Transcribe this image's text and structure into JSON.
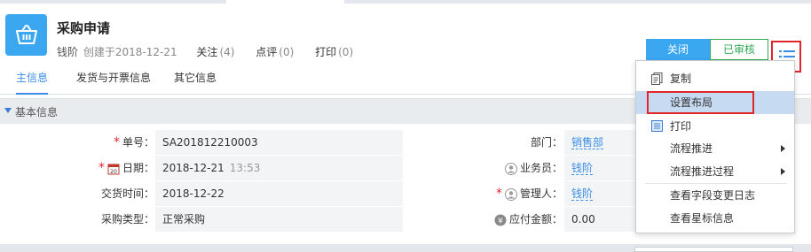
{
  "header": {
    "title": "采购申请",
    "creator": "钱阶",
    "created_text": "创建于2018-12-21",
    "actions": [
      {
        "label": "关注",
        "count": "(4)"
      },
      {
        "label": "点评",
        "count": "(0)"
      },
      {
        "label": "打印",
        "count": "(0)"
      }
    ],
    "close_label": "关闭",
    "status_label": "已审核",
    "menu_icon": "list-icon"
  },
  "tabs": [
    {
      "label": "主信息",
      "active": true
    },
    {
      "label": "发货与开票信息",
      "active": false
    },
    {
      "label": "其它信息",
      "active": false
    }
  ],
  "section": {
    "title": "基本信息"
  },
  "form": {
    "order_no": {
      "label": "单号：",
      "value": "SA201812210003"
    },
    "date": {
      "label": "日期：",
      "value": "2018-12-21",
      "time": "13:53"
    },
    "delivery_time": {
      "label": "交货时间：",
      "value": "2018-12-22"
    },
    "purchase_type": {
      "label": "采购类型：",
      "value": "正常采购"
    },
    "department": {
      "label": "部门：",
      "value": "销售部"
    },
    "salesperson": {
      "label": "业务员：",
      "value": "钱阶"
    },
    "manager": {
      "label": "管理人：",
      "value": "钱阶"
    },
    "amount_due": {
      "label": "应付金额：",
      "value": "0.00"
    }
  },
  "dropdown": {
    "items": [
      {
        "label": "复制",
        "icon": "copy-icon"
      },
      {
        "label": "设置布局",
        "highlighted": true
      },
      {
        "label": "打印",
        "icon": "print-icon"
      },
      {
        "label": "流程推进",
        "submenu": true
      },
      {
        "label": "流程推进过程",
        "submenu": true
      },
      {
        "label": "查看字段变更日志"
      },
      {
        "label": "查看星标信息"
      }
    ]
  },
  "colors": {
    "accent": "#3aa7f0",
    "status_green": "#33aa55",
    "highlight_red": "#e0262c",
    "link_blue": "#3a8ee6"
  }
}
